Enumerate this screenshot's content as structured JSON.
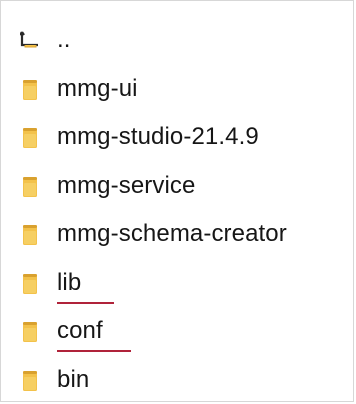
{
  "file_list": {
    "items": [
      {
        "label": "..",
        "icon": "parent-folder-icon"
      },
      {
        "label": "mmg-ui",
        "icon": "folder-icon"
      },
      {
        "label": "mmg-studio-21.4.9",
        "icon": "folder-icon"
      },
      {
        "label": "mmg-service",
        "icon": "folder-icon"
      },
      {
        "label": "mmg-schema-creator",
        "icon": "folder-icon"
      },
      {
        "label": "lib",
        "icon": "folder-icon",
        "annotation": "red-underline"
      },
      {
        "label": "conf",
        "icon": "folder-icon",
        "annotation": "red-underline"
      },
      {
        "label": "bin",
        "icon": "folder-icon"
      }
    ]
  },
  "colors": {
    "folder": "#f3c24b",
    "folder_shadow": "#d9a12f",
    "text": "#161616",
    "underline": "#b0233a",
    "border": "#d7d7d7"
  }
}
